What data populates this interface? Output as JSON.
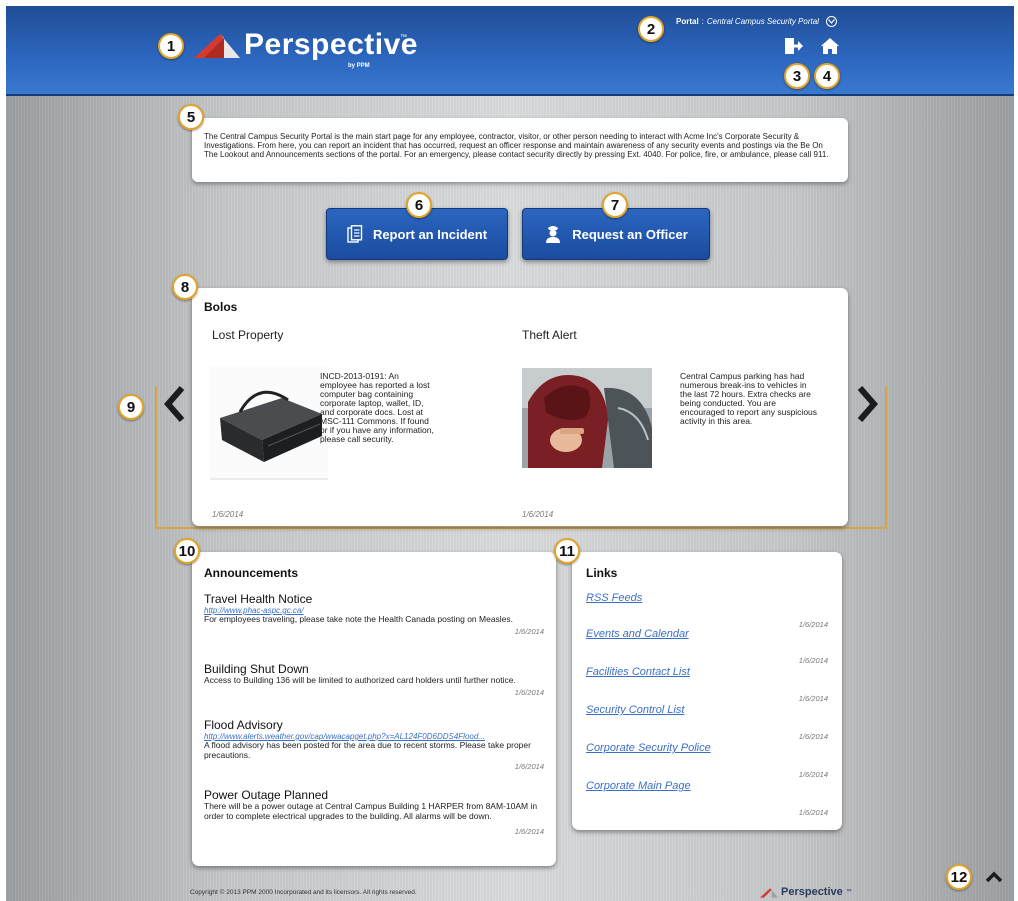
{
  "header": {
    "brand": "Perspective",
    "brand_sub": "by PPM",
    "brand_tm": "™",
    "portal_label": "Portal",
    "portal_separator": " : ",
    "portal_name": "Central Campus Security Portal",
    "icons": [
      "logout-icon",
      "home-icon"
    ]
  },
  "badges": [
    "1",
    "2",
    "3",
    "4",
    "5",
    "6",
    "7",
    "8",
    "9",
    "10",
    "11",
    "12"
  ],
  "intro": {
    "text": "The Central Campus Security Portal is the main start page for any employee, contractor, visitor, or other person needing to interact with Acme Inc's Corporate Security & Investigations. From here, you can report an incident that has occurred, request an officer response and maintain awareness of any security events and postings via the Be On The Lookout and Announcements sections of the portal. For an emergency, please contact security directly by pressing Ext. 4040. For police, fire, or ambulance, please call 911."
  },
  "actions": {
    "report_label": "Report an Incident",
    "report_icon": "report-icon",
    "request_label": "Request an Officer",
    "request_icon": "officer-icon"
  },
  "bolos": {
    "title": "Bolos",
    "items": [
      {
        "title": "Lost Property",
        "text": "INCD-2013-0191: An employee has reported a lost computer bag containing corporate laptop, wallet, ID, and corporate docs. Lost at MSC-111 Commons. If found or if you have any information, please call security.",
        "date": "1/6/2014",
        "image": "laptop-bag-image"
      },
      {
        "title": "Theft Alert",
        "text": "Central Campus parking has had numerous break-ins to vehicles in the last 72 hours. Extra checks are being conducted. You are encouraged to report any suspicious activity in this area.",
        "date": "1/6/2014",
        "image": "car-thief-image"
      }
    ]
  },
  "announcements": {
    "title": "Announcements",
    "items": [
      {
        "title": "Travel Health Notice",
        "link": "http://www.phac-aspc.gc.ca/",
        "body": "For employees traveling, please take note the Health Canada posting on Measles.",
        "date": "1/6/2014"
      },
      {
        "title": "Building Shut Down",
        "link": "",
        "body": "Access to Building 136 will be limited to authorized card holders until further notice.",
        "date": "1/6/2014"
      },
      {
        "title": "Flood Advisory",
        "link": "http://www.alerts.weather.gov/cap/wwacapget.php?x=AL124F0D6DDS4Flood...",
        "body": "A flood advisory has been posted for the area due to recent storms. Please take proper precautions.",
        "date": "1/6/2014"
      },
      {
        "title": "Power Outage Planned",
        "link": "",
        "body": "There will be a power outage at Central Campus Building 1 HARPER from 8AM-10AM in order to complete electrical upgrades to the building. All alarms will be down.",
        "date": "1/6/2014"
      }
    ]
  },
  "links": {
    "title": "Links",
    "items": [
      {
        "label": "RSS Feeds",
        "date": "1/6/2014"
      },
      {
        "label": "Events and Calendar",
        "date": "1/6/2014"
      },
      {
        "label": "Facilities Contact List",
        "date": "1/6/2014"
      },
      {
        "label": "Security Control List",
        "date": "1/6/2014"
      },
      {
        "label": "Corporate Security Police",
        "date": "1/6/2014"
      },
      {
        "label": "Corporate Main Page",
        "date": "1/6/2014"
      }
    ]
  },
  "footer": {
    "copyright": "Copyright © 2013 PPM 2000 Incorporated and its licensors. All rights reserved.",
    "brand": "Perspective",
    "brand_tm": "™"
  },
  "colors": {
    "header_blue": "#2d67bf",
    "badge_border": "#e2a52a",
    "link_blue": "#3a6fc9",
    "carousel_outline": "#d6a545",
    "logo_red": "#d43a2f"
  }
}
